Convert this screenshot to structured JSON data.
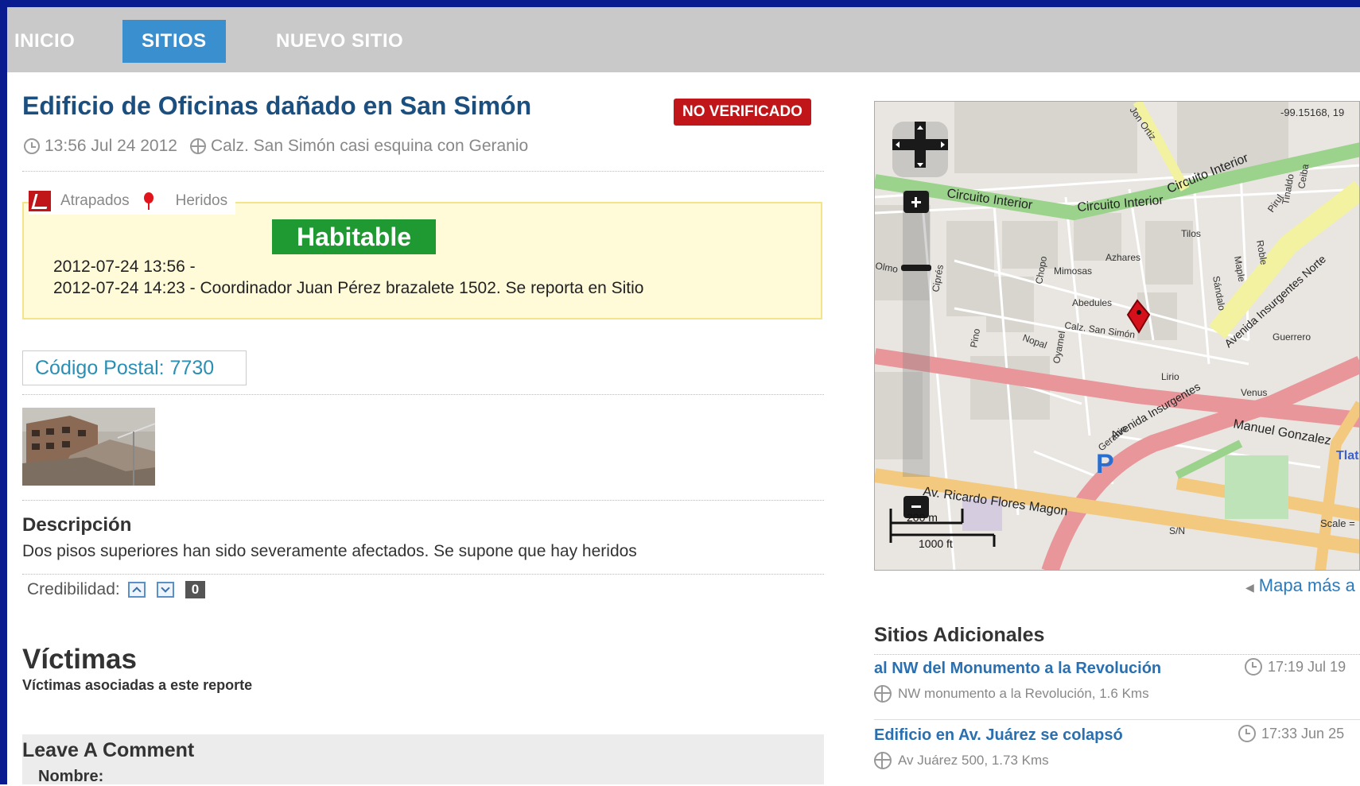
{
  "nav": {
    "items": [
      "INICIO",
      "SITIOS",
      "NUEVO SITIO"
    ]
  },
  "report": {
    "title": "Edificio de Oficinas dañado en San Simón",
    "verification": "NO VERIFICADO",
    "datetime": "13:56 Jul 24 2012",
    "location": "Calz. San Simón casi esquina con Geranio",
    "categories": [
      "Atrapados",
      "Heridos"
    ],
    "status": "Habitable",
    "history": [
      "2012-07-24 13:56 -",
      "2012-07-24 14:23 - Coordinador Juan Pérez brazalete 1502. Se reporta en Sitio"
    ],
    "postal_code": "Código Postal: 7730",
    "description_heading": "Descripción",
    "description": "Dos pisos superiores han sido severamente afectados. Se supone que hay heridos",
    "credibility_label": "Credibilidad:",
    "credibility_count": "0"
  },
  "victims": {
    "heading": "Víctimas",
    "subheading": "Víctimas asociadas a este reporte"
  },
  "comment": {
    "heading": "Leave A Comment",
    "name_label": "Nombre:"
  },
  "map": {
    "coords": "-99.15168, 19",
    "scale_m": "200 m",
    "scale_ft": "1000 ft",
    "scale_label": "Scale =",
    "more_link": "Mapa más a",
    "streets": [
      "Circuito Interior",
      "Circuito Interior",
      "Circuito Interior",
      "Av. Ricardo Flores Magon",
      "Avenida Insurgentes",
      "Avenida Insurgentes Norte",
      "Manuel Gonzalez",
      "Calz. San Simón",
      "Abedules",
      "Mimosas",
      "Azhares",
      "Tilos",
      "Guerrero",
      "Venus",
      "Nopal",
      "Oyamel",
      "Ciprés",
      "Pino",
      "Olmo",
      "Geranio",
      "Lirio",
      "S/N",
      "Tlate",
      "Maple",
      "Sándalo",
      "Chopo",
      "Pirul",
      "Ceiba",
      "Tinaldo",
      "Jon Ortiz",
      "Roble"
    ],
    "colors": {
      "major": "#e8969a",
      "primary": "#f3c97f",
      "secondary": "#f2f2a0",
      "trunk": "#9bd28c",
      "bg": "#e9e6e1"
    }
  },
  "sitios": {
    "heading": "Sitios Adicionales",
    "items": [
      {
        "title": "al NW del Monumento a la Revolución",
        "time": "17:19 Jul 19",
        "location": "NW monumento a la Revolución, 1.6 Kms"
      },
      {
        "title": "Edificio en Av. Juárez se colapsó",
        "time": "17:33 Jun 25",
        "location": "Av Juárez 500, 1.73 Kms"
      }
    ]
  }
}
